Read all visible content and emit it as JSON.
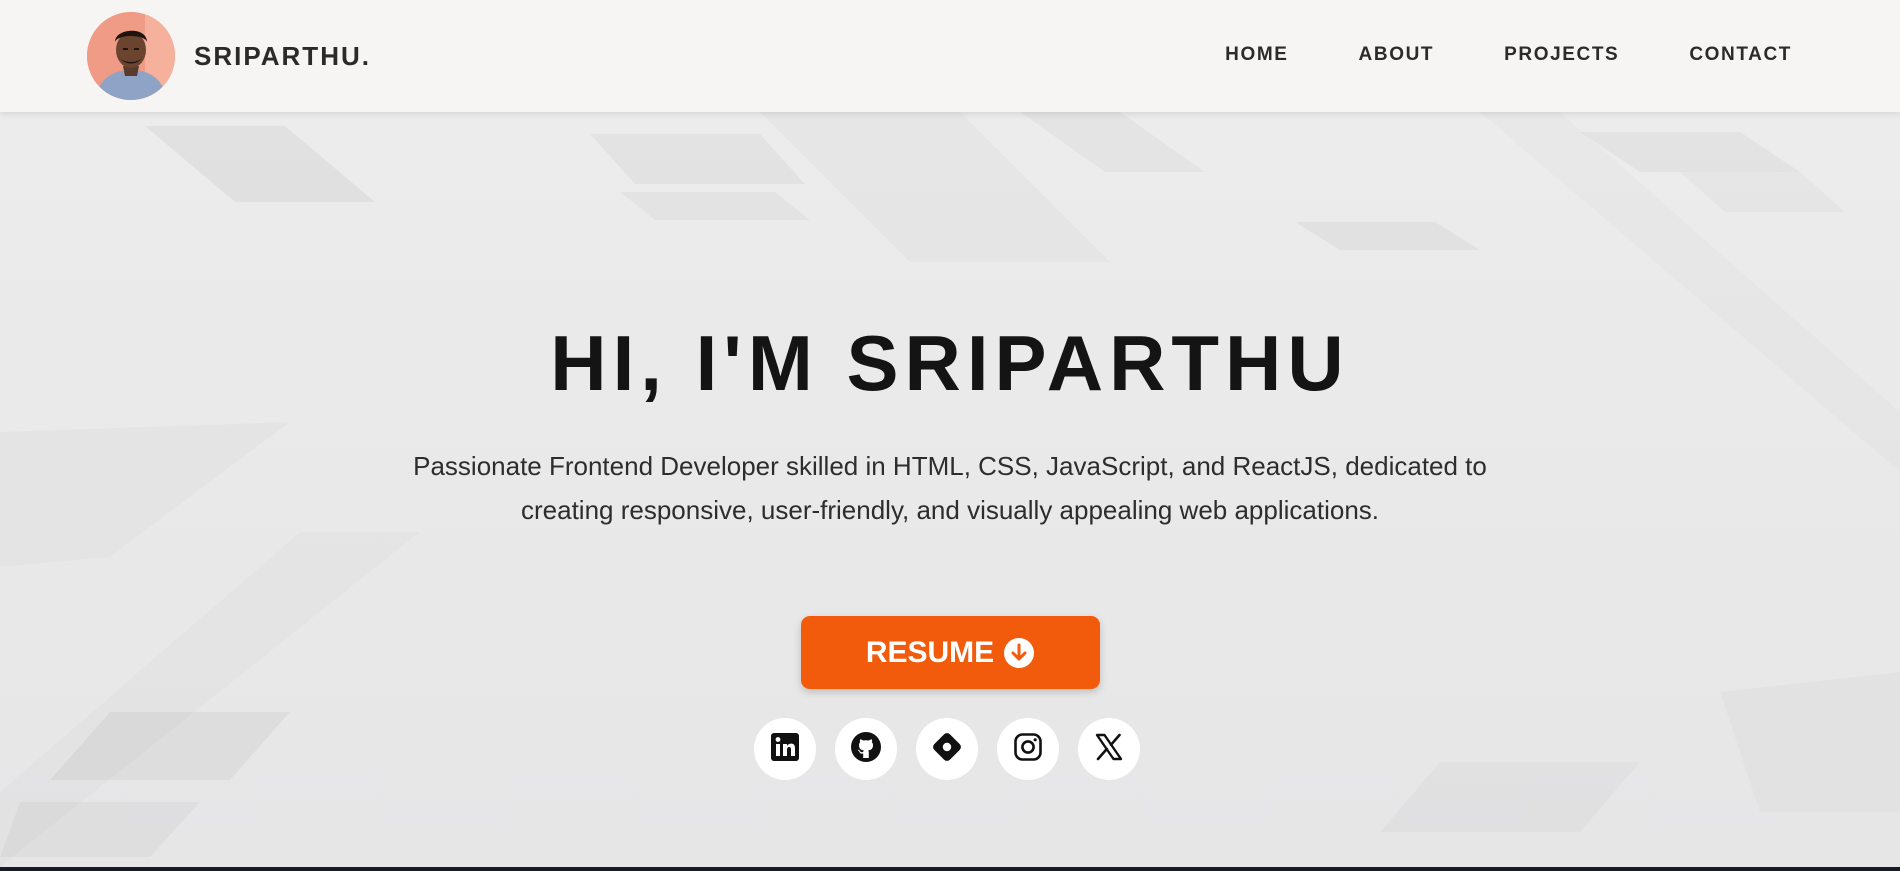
{
  "nav": {
    "brand": "SRIPARTHU.",
    "links": [
      "HOME",
      "ABOUT",
      "PROJECTS",
      "CONTACT"
    ]
  },
  "hero": {
    "title": "HI, I'M SRIPARTHU",
    "description": "Passionate Frontend Developer skilled in HTML, CSS, JavaScript, and ReactJS, dedicated to creating responsive, user-friendly, and visually appealing web applications.",
    "resume_label": "RESUME",
    "resume_icon": "download-circle-icon"
  },
  "socials": [
    {
      "name": "linkedin-icon"
    },
    {
      "name": "github-icon"
    },
    {
      "name": "diamond-icon"
    },
    {
      "name": "instagram-icon"
    },
    {
      "name": "x-icon"
    }
  ],
  "colors": {
    "accent": "#f25a0c",
    "navbar_bg": "#f6f5f3",
    "hero_bg": "#e9e9ea",
    "text_dark": "#141414",
    "bottom_strip": "#161b29"
  }
}
